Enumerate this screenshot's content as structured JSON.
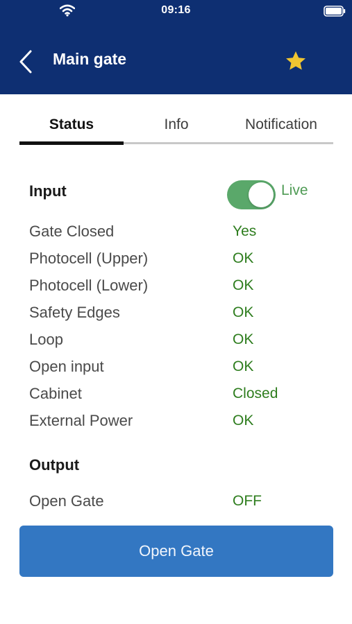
{
  "status_bar": {
    "time": "09:16",
    "icons": [
      "wifi-icon",
      "battery-icon"
    ]
  },
  "header": {
    "title": "Main gate",
    "back_icon": "chevron-left-icon",
    "favorite_icon": "star-icon",
    "background_color": "#0e2f72",
    "star_color": "#f0c531"
  },
  "tabs": [
    {
      "label": "Status",
      "active": true
    },
    {
      "label": "Info",
      "active": false
    },
    {
      "label": "Notification",
      "active": false
    }
  ],
  "input_section": {
    "title": "Input",
    "live_toggle": {
      "label": "Live",
      "on": true,
      "color": "#5aa86a"
    },
    "rows": [
      {
        "label": "Gate Closed",
        "value": "Yes"
      },
      {
        "label": "Photocell (Upper)",
        "value": "OK"
      },
      {
        "label": "Photocell (Lower)",
        "value": "OK"
      },
      {
        "label": "Safety Edges",
        "value": "OK"
      },
      {
        "label": "Loop",
        "value": "OK"
      },
      {
        "label": "Open input",
        "value": "OK"
      },
      {
        "label": "Cabinet",
        "value": "Closed"
      },
      {
        "label": "External Power",
        "value": "OK"
      }
    ]
  },
  "output_section": {
    "title": "Output",
    "rows": [
      {
        "label": "Open Gate",
        "value": "OFF"
      }
    ]
  },
  "actions": {
    "open_gate_label": "Open Gate",
    "button_color": "#3377c2"
  },
  "colors": {
    "status_value": "#2e7d1e"
  }
}
